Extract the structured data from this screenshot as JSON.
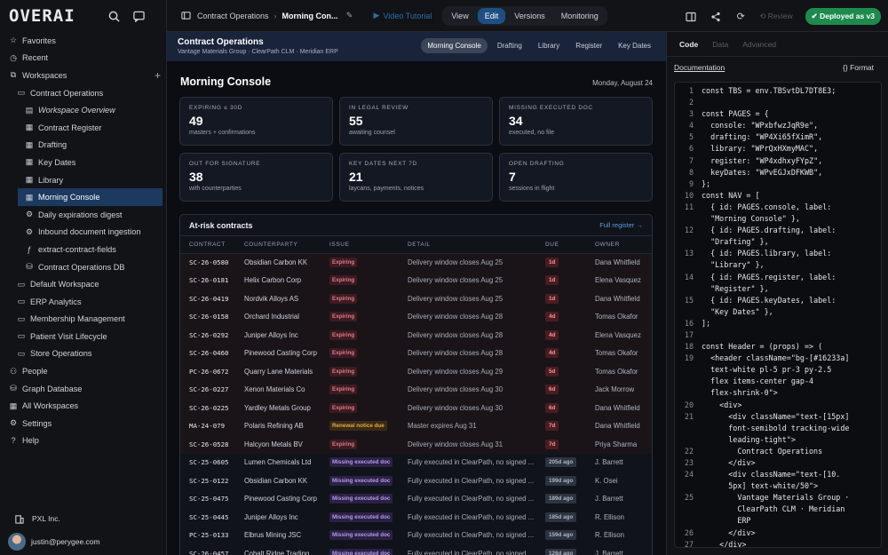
{
  "app": {
    "logo": "OVERAI"
  },
  "sidebar": {
    "items": [
      {
        "label": "Favorites",
        "icon": "star-icon",
        "level": 0
      },
      {
        "label": "Recent",
        "icon": "clock-icon",
        "level": 0
      },
      {
        "label": "Workspaces",
        "icon": "layers-icon",
        "level": 0,
        "plus": true
      },
      {
        "label": "Contract Operations",
        "icon": "folder-icon",
        "level": 1
      },
      {
        "label": "Workspace Overview",
        "icon": "book-icon",
        "level": 2,
        "italic": true
      },
      {
        "label": "Contract Register",
        "icon": "grid-icon",
        "level": 2
      },
      {
        "label": "Drafting",
        "icon": "grid-icon",
        "level": 2
      },
      {
        "label": "Key Dates",
        "icon": "grid-icon",
        "level": 2
      },
      {
        "label": "Library",
        "icon": "grid-icon",
        "level": 2
      },
      {
        "label": "Morning Console",
        "icon": "grid-icon",
        "level": 2,
        "active": true
      },
      {
        "label": "Daily expirations digest",
        "icon": "gear-icon",
        "level": 2
      },
      {
        "label": "Inbound document ingestion",
        "icon": "gear-icon",
        "level": 2
      },
      {
        "label": "extract-contract-fields",
        "icon": "function-icon",
        "level": 2
      },
      {
        "label": "Contract Operations DB",
        "icon": "database-icon",
        "level": 2
      },
      {
        "label": "Default Workspace",
        "icon": "folder-icon",
        "level": 1
      },
      {
        "label": "ERP Analytics",
        "icon": "folder-icon",
        "level": 1
      },
      {
        "label": "Membership Management",
        "icon": "folder-icon",
        "level": 1
      },
      {
        "label": "Patient Visit Lifecycle",
        "icon": "folder-icon",
        "level": 1
      },
      {
        "label": "Store Operations",
        "icon": "folder-icon",
        "level": 1
      },
      {
        "label": "People",
        "icon": "people-icon",
        "level": 0
      },
      {
        "label": "Graph Database",
        "icon": "database-icon",
        "level": 0
      },
      {
        "label": "All Workspaces",
        "icon": "grid-icon",
        "level": 0
      },
      {
        "label": "Settings",
        "icon": "gear-icon",
        "level": 0
      },
      {
        "label": "Help",
        "icon": "help-icon",
        "level": 0
      }
    ],
    "org": "PXL Inc.",
    "user": "justin@perygee.com"
  },
  "topbar": {
    "crumb_parent": "Contract Operations",
    "crumb_current": "Morning Con...",
    "video": "Video Tutorial",
    "modes": [
      "View",
      "Edit",
      "Versions",
      "Monitoring"
    ],
    "active_mode": "Edit",
    "review": "Review",
    "deployed": "Deployed as v3"
  },
  "main": {
    "header_title": "Contract Operations",
    "header_sub": "Vantage Materials Group · ClearPath CLM · Meridian ERP",
    "tabs": [
      "Morning Console",
      "Drafting",
      "Library",
      "Register",
      "Key Dates"
    ],
    "page_title": "Morning Console",
    "date": "Monday, August 24",
    "cards": [
      {
        "label": "Expiring ≤ 30d",
        "value": "49",
        "sub": "masters + confirmations"
      },
      {
        "label": "In legal review",
        "value": "55",
        "sub": "awaiting counsel"
      },
      {
        "label": "Missing executed doc",
        "value": "34",
        "sub": "executed, no file"
      },
      {
        "label": "Out for signature",
        "value": "38",
        "sub": "with counterparties"
      },
      {
        "label": "Key dates next 7d",
        "value": "21",
        "sub": "laycans, payments, notices"
      },
      {
        "label": "Open drafting",
        "value": "7",
        "sub": "sessions in flight"
      }
    ],
    "table_title": "At-risk contracts",
    "table_link": "Full register →",
    "columns": [
      "CONTRACT",
      "COUNTERPARTY",
      "ISSUE",
      "DETAIL",
      "DUE",
      "OWNER"
    ],
    "rows": [
      {
        "contract": "SC-26-0580",
        "party": "Obsidian Carbon KK",
        "issue": "Expiring",
        "kind": "exp",
        "detail": "Delivery window closes Aug 25",
        "due": "1d",
        "owner": "Dana Whitfield"
      },
      {
        "contract": "SC-26-0181",
        "party": "Helix Carbon Corp",
        "issue": "Expiring",
        "kind": "exp",
        "detail": "Delivery window closes Aug 25",
        "due": "1d",
        "owner": "Elena Vasquez"
      },
      {
        "contract": "SC-26-0419",
        "party": "Nordvik Alloys AS",
        "issue": "Expiring",
        "kind": "exp",
        "detail": "Delivery window closes Aug 25",
        "due": "1d",
        "owner": "Dana Whitfield"
      },
      {
        "contract": "SC-26-0158",
        "party": "Orchard Industrial",
        "issue": "Expiring",
        "kind": "exp",
        "detail": "Delivery window closes Aug 28",
        "due": "4d",
        "owner": "Tomas Okafor"
      },
      {
        "contract": "SC-26-0292",
        "party": "Juniper Alloys Inc",
        "issue": "Expiring",
        "kind": "exp",
        "detail": "Delivery window closes Aug 28",
        "due": "4d",
        "owner": "Elena Vasquez"
      },
      {
        "contract": "SC-26-0460",
        "party": "Pinewood Casting Corp",
        "issue": "Expiring",
        "kind": "exp",
        "detail": "Delivery window closes Aug 28",
        "due": "4d",
        "owner": "Tomas Okafor"
      },
      {
        "contract": "PC-26-0672",
        "party": "Quarry Lane Materials",
        "issue": "Expiring",
        "kind": "exp",
        "detail": "Delivery window closes Aug 29",
        "due": "5d",
        "owner": "Tomas Okafor"
      },
      {
        "contract": "SC-26-0227",
        "party": "Xenon Materials Co",
        "issue": "Expiring",
        "kind": "exp",
        "detail": "Delivery window closes Aug 30",
        "due": "6d",
        "owner": "Jack Morrow"
      },
      {
        "contract": "SC-26-0225",
        "party": "Yardley Metals Group",
        "issue": "Expiring",
        "kind": "exp",
        "detail": "Delivery window closes Aug 30",
        "due": "6d",
        "owner": "Dana Whitfield"
      },
      {
        "contract": "MA-24-079",
        "party": "Polaris Refining AB",
        "issue": "Renewal notice due",
        "kind": "ren",
        "detail": "Master expires Aug 31",
        "due": "7d",
        "owner": "Dana Whitfield"
      },
      {
        "contract": "SC-26-0528",
        "party": "Halcyon Metals BV",
        "issue": "Expiring",
        "kind": "exp",
        "detail": "Delivery window closes Aug 31",
        "due": "7d",
        "owner": "Priya Sharma"
      },
      {
        "contract": "SC-25-0605",
        "party": "Lumen Chemicals Ltd",
        "issue": "Missing executed doc",
        "kind": "mis",
        "detail": "Fully executed in ClearPath, no signed ...",
        "due": "205d ago",
        "owner": "J. Barrett"
      },
      {
        "contract": "SC-25-0122",
        "party": "Obsidian Carbon KK",
        "issue": "Missing executed doc",
        "kind": "mis",
        "detail": "Fully executed in ClearPath, no signed ...",
        "due": "199d ago",
        "owner": "K. Osei"
      },
      {
        "contract": "SC-25-0475",
        "party": "Pinewood Casting Corp",
        "issue": "Missing executed doc",
        "kind": "mis",
        "detail": "Fully executed in ClearPath, no signed ...",
        "due": "189d ago",
        "owner": "J. Barrett"
      },
      {
        "contract": "SC-25-0445",
        "party": "Juniper Alloys Inc",
        "issue": "Missing executed doc",
        "kind": "mis",
        "detail": "Fully executed in ClearPath, no signed ...",
        "due": "185d ago",
        "owner": "R. Ellison"
      },
      {
        "contract": "PC-25-0133",
        "party": "Elbrus Mining JSC",
        "issue": "Missing executed doc",
        "kind": "mis",
        "detail": "Fully executed in ClearPath, no signed ...",
        "due": "159d ago",
        "owner": "R. Ellison"
      },
      {
        "contract": "SC-26-0457",
        "party": "Cobalt Ridge Trading",
        "issue": "Missing executed doc",
        "kind": "mis",
        "detail": "Fully executed in ClearPath, no signed ...",
        "due": "128d ago",
        "owner": "J. Barrett"
      }
    ]
  },
  "code_pane": {
    "tabs": [
      "Code",
      "Data",
      "Advanced"
    ],
    "active_tab": "Code",
    "doc_link": "Documentation",
    "format": "{} Format",
    "lines": [
      {
        "n": "1",
        "t": "const TBS = env.TBSvtDL7DT8E3;"
      },
      {
        "n": "2",
        "t": ""
      },
      {
        "n": "3",
        "t": "const PAGES = {"
      },
      {
        "n": "4",
        "t": "  console: \"WPxbfwzJqR9e\","
      },
      {
        "n": "5",
        "t": "  drafting: \"WP4Xi65fXimR\","
      },
      {
        "n": "6",
        "t": "  library: \"WPrQxHXmyMAC\","
      },
      {
        "n": "7",
        "t": "  register: \"WP4xdhxyFYpZ\","
      },
      {
        "n": "8",
        "t": "  keyDates: \"WPvEGJxDFKWB\","
      },
      {
        "n": "9",
        "t": "};"
      },
      {
        "n": "10",
        "t": "const NAV = ["
      },
      {
        "n": "11",
        "t": "  { id: PAGES.console, label:"
      },
      {
        "n": "",
        "t": "  \"Morning Console\" },"
      },
      {
        "n": "12",
        "t": "  { id: PAGES.drafting, label:"
      },
      {
        "n": "",
        "t": "  \"Drafting\" },"
      },
      {
        "n": "13",
        "t": "  { id: PAGES.library, label:"
      },
      {
        "n": "",
        "t": "  \"Library\" },"
      },
      {
        "n": "14",
        "t": "  { id: PAGES.register, label:"
      },
      {
        "n": "",
        "t": "  \"Register\" },"
      },
      {
        "n": "15",
        "t": "  { id: PAGES.keyDates, label:"
      },
      {
        "n": "",
        "t": "  \"Key Dates\" },"
      },
      {
        "n": "16",
        "t": "];"
      },
      {
        "n": "17",
        "t": ""
      },
      {
        "n": "18",
        "t": "const Header = (props) => ("
      },
      {
        "n": "19",
        "t": "  <header className=\"bg-[#16233a]"
      },
      {
        "n": "",
        "t": "  text-white pl-5 pr-3 py-2.5"
      },
      {
        "n": "",
        "t": "  flex items-center gap-4"
      },
      {
        "n": "",
        "t": "  flex-shrink-0\">"
      },
      {
        "n": "20",
        "t": "    <div>"
      },
      {
        "n": "21",
        "t": "      <div className=\"text-[15px]"
      },
      {
        "n": "",
        "t": "      font-semibold tracking-wide"
      },
      {
        "n": "",
        "t": "      leading-tight\">"
      },
      {
        "n": "22",
        "t": "        Contract Operations"
      },
      {
        "n": "23",
        "t": "      </div>"
      },
      {
        "n": "24",
        "t": "      <div className=\"text-[10."
      },
      {
        "n": "",
        "t": "      5px] text-white/50\">"
      },
      {
        "n": "25",
        "t": "        Vantage Materials Group ·"
      },
      {
        "n": "",
        "t": "        ClearPath CLM · Meridian"
      },
      {
        "n": "",
        "t": "        ERP"
      },
      {
        "n": "26",
        "t": "      </div>"
      },
      {
        "n": "27",
        "t": "    </div>"
      }
    ]
  }
}
